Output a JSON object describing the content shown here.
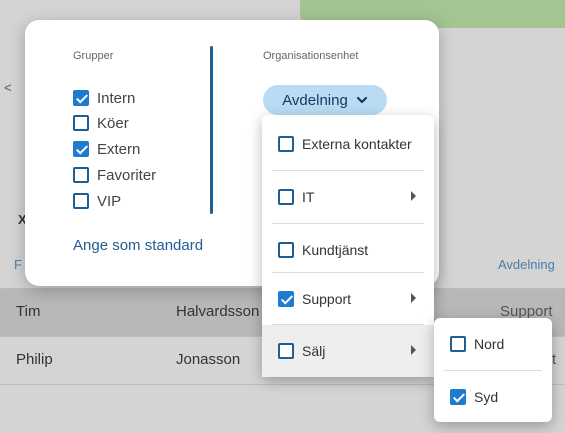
{
  "background": {
    "columns": {
      "first": "F",
      "dept": "Avdelning"
    },
    "fragments": {
      "back": "<",
      "close": "X"
    },
    "rows": [
      {
        "first": "Tim",
        "last": "Halvardsson",
        "dept": "Support",
        "selected": true
      },
      {
        "first": "Philip",
        "last": "Jonasson",
        "dept": "t",
        "selected": false
      }
    ]
  },
  "popup": {
    "groups_title": "Grupper",
    "org_title": "Organisationsenhet",
    "groups": [
      {
        "label": "Intern",
        "checked": true
      },
      {
        "label": "Köer",
        "checked": false
      },
      {
        "label": "Extern",
        "checked": true
      },
      {
        "label": "Favoriter",
        "checked": false
      },
      {
        "label": "VIP",
        "checked": false
      }
    ],
    "set_default_label": "Ange som standard",
    "dept_button_label": "Avdelning"
  },
  "menu": {
    "items": [
      {
        "label": "Externa kontakter",
        "checked": false,
        "has_submenu": false
      },
      {
        "label": "IT",
        "checked": false,
        "has_submenu": true
      },
      {
        "label": "Kundtjänst",
        "checked": false,
        "has_submenu": false
      },
      {
        "label": "Support",
        "checked": true,
        "has_submenu": true
      },
      {
        "label": "Sälj",
        "checked": false,
        "has_submenu": true,
        "active": true
      }
    ]
  },
  "submenu": {
    "items": [
      {
        "label": "Nord",
        "checked": false
      },
      {
        "label": "Syd",
        "checked": true
      }
    ]
  },
  "colors": {
    "accent": "#1f7bd0",
    "divider": "#1f5d94",
    "pill": "#b9dcf4"
  }
}
